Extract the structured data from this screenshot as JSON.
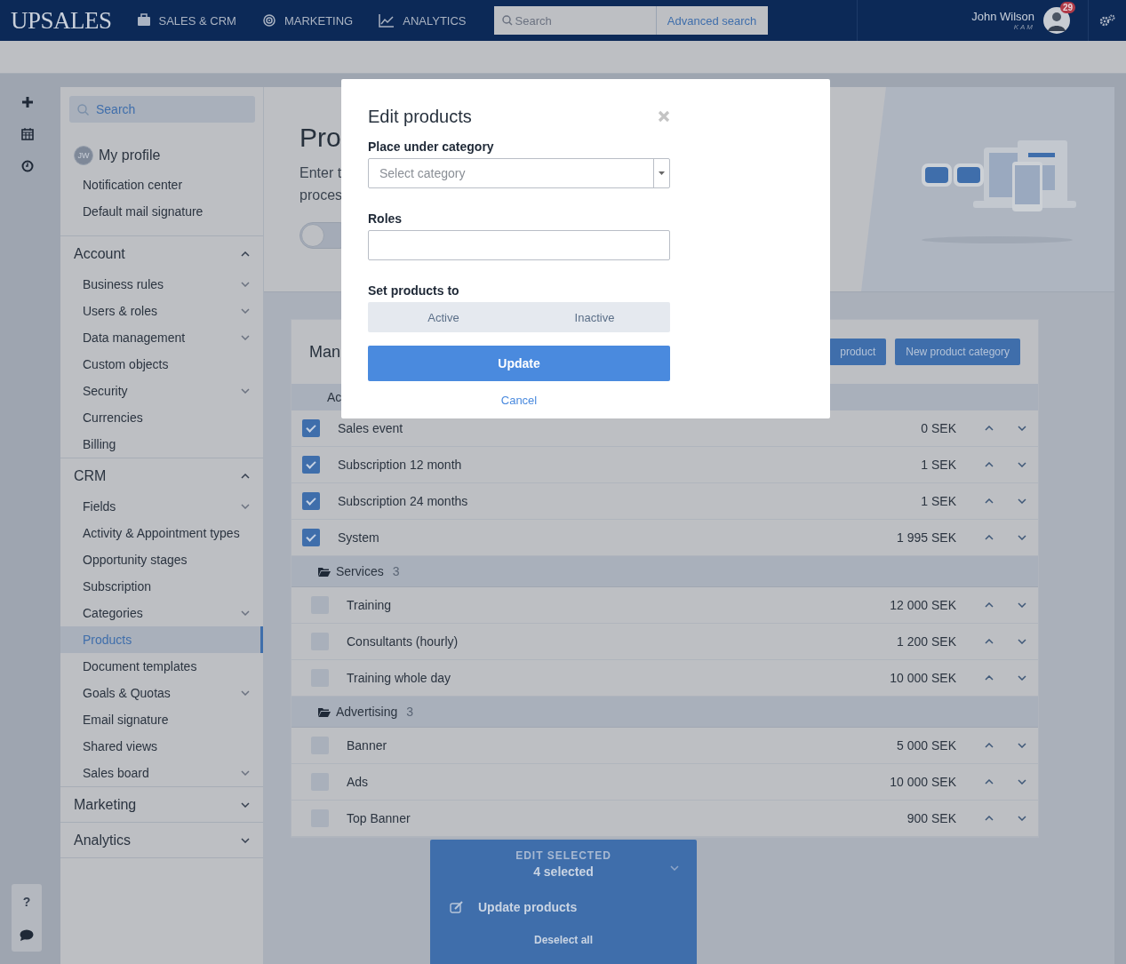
{
  "topbar": {
    "logo": "UPSALES",
    "nav": [
      {
        "label": "SALES & CRM"
      },
      {
        "label": "MARKETING"
      },
      {
        "label": "ANALYTICS"
      }
    ],
    "search": {
      "placeholder": "Search"
    },
    "advanced_search": "Advanced search",
    "user": {
      "name": "John Wilson",
      "role": "KAM",
      "badge": "29"
    }
  },
  "rail": {
    "help": "?"
  },
  "sidebar": {
    "search": {
      "placeholder": "Search"
    },
    "profile": {
      "initials": "JW",
      "label": "My profile",
      "items": [
        "Notification center",
        "Default mail signature"
      ]
    },
    "sections": [
      {
        "label": "Account",
        "expanded": true,
        "items": [
          {
            "label": "Business rules",
            "expandable": true,
            "selected": false
          },
          {
            "label": "Users & roles",
            "expandable": true,
            "selected": false
          },
          {
            "label": "Data management",
            "expandable": true,
            "selected": false
          },
          {
            "label": "Custom objects",
            "expandable": false,
            "selected": false
          },
          {
            "label": "Security",
            "expandable": true,
            "selected": false
          },
          {
            "label": "Currencies",
            "expandable": false,
            "selected": false
          },
          {
            "label": "Billing",
            "expandable": false,
            "selected": false
          }
        ]
      },
      {
        "label": "CRM",
        "expanded": true,
        "items": [
          {
            "label": "Fields",
            "expandable": true,
            "selected": false
          },
          {
            "label": "Activity & Appointment types",
            "expandable": false,
            "selected": false
          },
          {
            "label": "Opportunity stages",
            "expandable": false,
            "selected": false
          },
          {
            "label": "Subscription",
            "expandable": false,
            "selected": false
          },
          {
            "label": "Categories",
            "expandable": true,
            "selected": false
          },
          {
            "label": "Products",
            "expandable": false,
            "selected": true
          },
          {
            "label": "Document templates",
            "expandable": false,
            "selected": false
          },
          {
            "label": "Goals & Quotas",
            "expandable": true,
            "selected": false
          },
          {
            "label": "Email signature",
            "expandable": false,
            "selected": false
          },
          {
            "label": "Shared views",
            "expandable": false,
            "selected": false
          },
          {
            "label": "Sales board",
            "expandable": true,
            "selected": false
          }
        ]
      },
      {
        "label": "Marketing",
        "expanded": false
      },
      {
        "label": "Analytics",
        "expanded": false
      }
    ]
  },
  "header": {
    "title": "Pro",
    "text_lines": [
      "Enter t",
      "proces"
    ],
    "toggle": {
      "on": false
    }
  },
  "products_card": {
    "title": "Man",
    "buttons": [
      "product",
      "New product category"
    ],
    "column_1": "Ac",
    "groups": [
      {
        "rows": [
          {
            "name": "Sales event",
            "price": "0 SEK",
            "checked": true
          },
          {
            "name": "Subscription 12 month",
            "price": "1 SEK",
            "checked": true
          },
          {
            "name": "Subscription 24 months",
            "price": "1 SEK",
            "checked": true
          },
          {
            "name": "System",
            "price": "1 995 SEK",
            "checked": true
          }
        ]
      },
      {
        "name": "Services",
        "count": "3",
        "rows": [
          {
            "name": "Training",
            "price": "12 000 SEK",
            "checked": false
          },
          {
            "name": "Consultants (hourly)",
            "price": "1 200 SEK",
            "checked": false
          },
          {
            "name": "Training whole day",
            "price": "10 000 SEK",
            "checked": false
          }
        ]
      },
      {
        "name": "Advertising",
        "count": "3",
        "rows": [
          {
            "name": "Banner",
            "price": "5 000 SEK",
            "checked": false
          },
          {
            "name": "Ads",
            "price": "10 000 SEK",
            "checked": false
          },
          {
            "name": "Top Banner",
            "price": "900 SEK",
            "checked": false
          }
        ]
      }
    ]
  },
  "modal": {
    "title": "Edit products",
    "category_label": "Place under category",
    "category": {
      "placeholder": "Select category"
    },
    "roles_label": "Roles",
    "status_label": "Set products to",
    "status_options": [
      {
        "label": "Active",
        "selected": false
      },
      {
        "label": "Inactive",
        "selected": false
      }
    ],
    "submit": "Update",
    "cancel": "Cancel"
  },
  "edit_panel": {
    "title": "EDIT SELECTED",
    "count": "4 selected",
    "action": "Update products",
    "deselect": "Deselect all"
  }
}
